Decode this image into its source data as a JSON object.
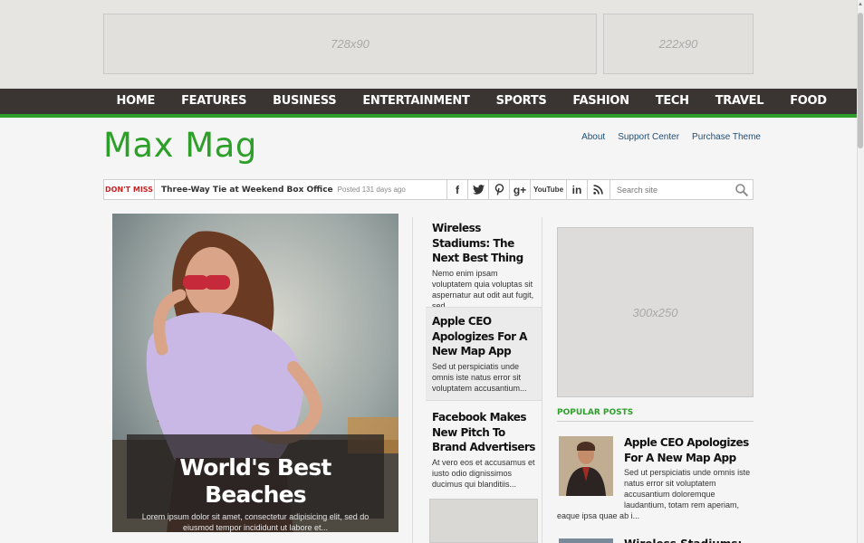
{
  "ads": {
    "top_left": "728x90",
    "top_right": "222x90",
    "sidebar": "300x250"
  },
  "nav": {
    "items": [
      "HOME",
      "FEATURES",
      "BUSINESS",
      "ENTERTAINMENT",
      "SPORTS",
      "FASHION",
      "TECH",
      "TRAVEL",
      "FOOD"
    ]
  },
  "header": {
    "logo": "Max Mag",
    "links": [
      "About",
      "Support Center",
      "Purchase Theme"
    ]
  },
  "ticker": {
    "label": "DON'T MISS",
    "headline": "Three-Way Tie at Weekend Box Office",
    "meta": "Posted 131 days ago",
    "social_icons": [
      "facebook-icon",
      "twitter-icon",
      "pinterest-icon",
      "google-plus-icon",
      "youtube-icon",
      "linkedin-icon",
      "rss-icon"
    ],
    "social_glyphs": {
      "facebook": "f",
      "twitter": "t",
      "pinterest": "p",
      "googleplus": "g+",
      "youtube": "YouTube",
      "linkedin": "in",
      "rss": "rss"
    },
    "search_placeholder": "Search site"
  },
  "hero": {
    "title": "World's Best Beaches",
    "excerpt": "Lorem ipsum dolor sit amet, consectetur adipisicing elit, sed do eiusmod tempor incididunt ut labore et..."
  },
  "stories": [
    {
      "title": "Wireless Stadiums: The Next Best Thing",
      "excerpt": "Nemo enim ipsam voluptatem quia voluptas sit aspernatur aut odit aut fugit, sed..."
    },
    {
      "title": "Apple CEO Apologizes For A New Map App",
      "excerpt": "Sed ut perspiciatis unde omnis iste natus error sit voluptatem accusantium..."
    },
    {
      "title": "Facebook Makes New Pitch To Brand Advertisers",
      "excerpt": "At vero eos et accusamus et iusto odio dignissimos ducimus qui blanditiis..."
    }
  ],
  "popular": {
    "heading": "POPULAR POSTS",
    "items": [
      {
        "title": "Apple CEO Apologizes For A New Map App",
        "excerpt": "Sed ut perspiciatis unde omnis iste natus error sit voluptatem accusantium doloremque laudantium, totam rem aperiam,",
        "excerpt_cont": "eaque ipsa quae ab i..."
      },
      {
        "title": "Wireless Stadiums: The"
      }
    ]
  },
  "colors": {
    "brand_green": "#2ea02a",
    "nav_bg": "#3a3532",
    "dont_miss_red": "#cc2222",
    "link_blue": "#1d4e7a"
  }
}
